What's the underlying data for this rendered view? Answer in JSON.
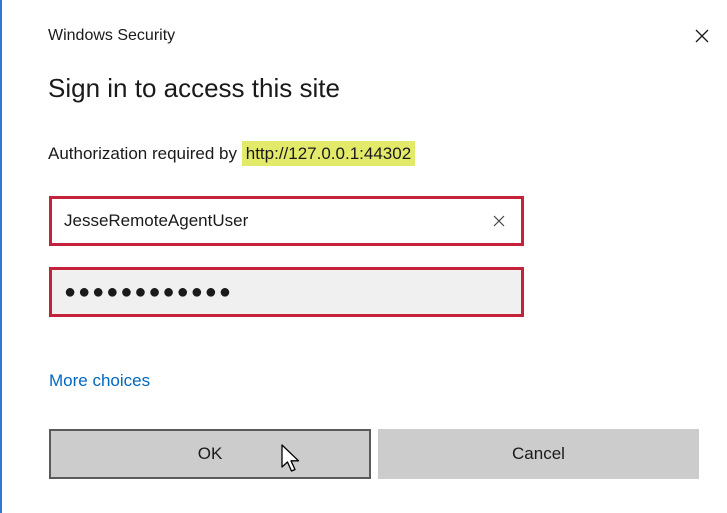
{
  "dialog": {
    "window_title": "Windows Security",
    "heading": "Sign in to access this site",
    "auth_prefix": "Authorization required by ",
    "auth_url": "http://127.0.0.1:44302",
    "username": {
      "value": "JesseRemoteAgentUser",
      "clear_icon": "close-icon"
    },
    "password": {
      "value": "●●●●●●●●●●●●"
    },
    "more_choices": "More choices",
    "buttons": {
      "ok": "OK",
      "cancel": "Cancel"
    }
  },
  "icons": {
    "close": "close-icon",
    "cursor": "mouse-pointer-icon"
  },
  "colors": {
    "accent_border": "#2b79d6",
    "field_error_border": "#c4213a",
    "url_highlight": "#e3ea6a",
    "link": "#0067c0",
    "button_bg": "#cccccc"
  }
}
